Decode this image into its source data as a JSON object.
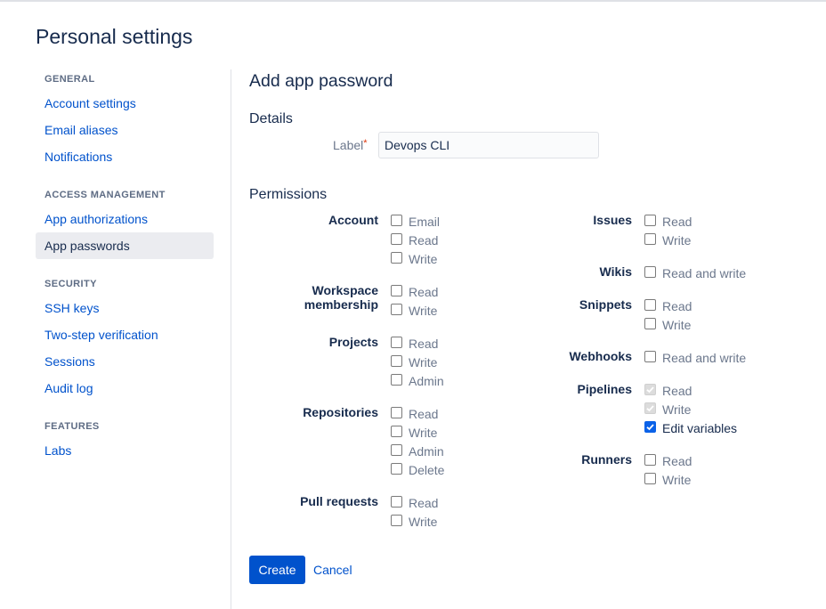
{
  "page": {
    "title": "Personal settings"
  },
  "sidebar": {
    "sections": [
      {
        "heading": "GENERAL",
        "items": [
          "Account settings",
          "Email aliases",
          "Notifications"
        ]
      },
      {
        "heading": "ACCESS MANAGEMENT",
        "items": [
          "App authorizations",
          "App passwords"
        ]
      },
      {
        "heading": "SECURITY",
        "items": [
          "SSH keys",
          "Two-step verification",
          "Sessions",
          "Audit log"
        ]
      },
      {
        "heading": "FEATURES",
        "items": [
          "Labs"
        ]
      }
    ],
    "active_item": "App passwords"
  },
  "form": {
    "title": "Add app password",
    "details_heading": "Details",
    "label_field": {
      "label": "Label",
      "required_marker": "*",
      "value": "Devops CLI"
    },
    "permissions_heading": "Permissions",
    "left_groups": [
      {
        "label": "Account",
        "options": [
          "Email",
          "Read",
          "Write"
        ]
      },
      {
        "label": "Workspace membership",
        "label_lines": [
          "Workspace",
          "membership"
        ],
        "options": [
          "Read",
          "Write"
        ]
      },
      {
        "label": "Projects",
        "options": [
          "Read",
          "Write",
          "Admin"
        ]
      },
      {
        "label": "Repositories",
        "options": [
          "Read",
          "Write",
          "Admin",
          "Delete"
        ]
      },
      {
        "label": "Pull requests",
        "options": [
          "Read",
          "Write"
        ]
      }
    ],
    "right_groups": [
      {
        "label": "Issues",
        "options": [
          "Read",
          "Write"
        ]
      },
      {
        "label": "Wikis",
        "options": [
          "Read and write"
        ]
      },
      {
        "label": "Snippets",
        "options": [
          "Read",
          "Write"
        ]
      },
      {
        "label": "Webhooks",
        "options": [
          "Read and write"
        ]
      },
      {
        "label": "Pipelines",
        "options": [
          "Read",
          "Write",
          "Edit variables"
        ],
        "states": [
          "checked-disabled",
          "checked-disabled",
          "checked"
        ]
      },
      {
        "label": "Runners",
        "options": [
          "Read",
          "Write"
        ]
      }
    ],
    "create_label": "Create",
    "cancel_label": "Cancel"
  },
  "colors": {
    "link": "#0052cc",
    "primary_button": "#0052cc",
    "checkbox_checked": "#0b62e8",
    "required": "#de350b"
  }
}
